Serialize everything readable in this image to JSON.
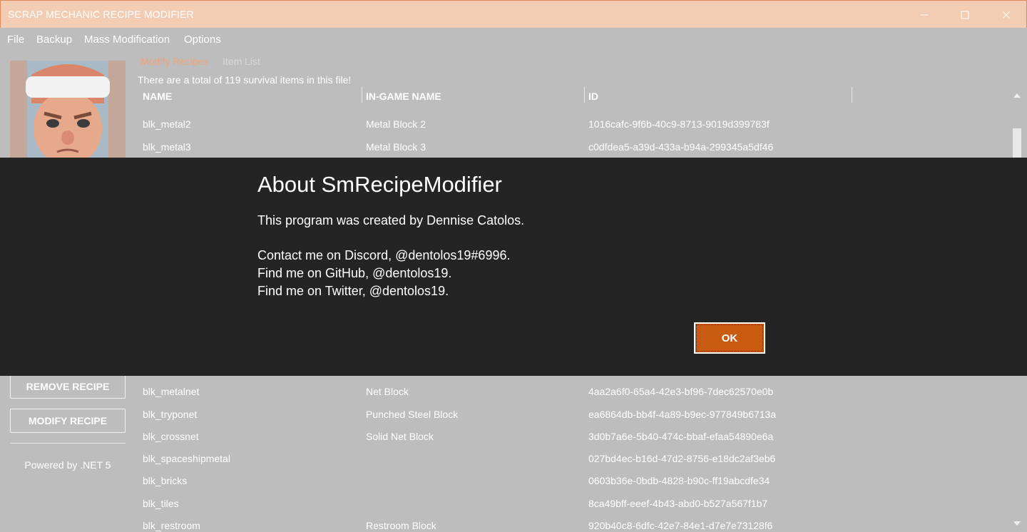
{
  "window": {
    "title": "SCRAP MECHANIC RECIPE MODIFIER",
    "minimize_icon": "minimize-icon",
    "maximize_icon": "maximize-icon",
    "close_icon": "close-icon"
  },
  "menu": [
    "File",
    "Backup",
    "Mass Modification",
    "Options"
  ],
  "tabs": {
    "modify": "Modify Recipes",
    "items": "Item List"
  },
  "info": {
    "total": "There are a total of 119 survival items in this file!"
  },
  "table": {
    "headers": [
      "NAME",
      "IN-GAME NAME",
      "ID"
    ],
    "top_rows": [
      {
        "name": "blk_metal2",
        "game": "Metal Block 2",
        "id": "1016cafc-9f6b-40c9-8713-9019d399783f"
      },
      {
        "name": "blk_metal3",
        "game": "Metal Block 3",
        "id": "c0dfdea5-a39d-433a-b94a-299345a5df46"
      }
    ],
    "bottom_rows": [
      {
        "name": "blk_metalnet",
        "game": "Net Block",
        "id": "4aa2a6f0-65a4-42e3-bf96-7dec62570e0b"
      },
      {
        "name": "blk_tryponet",
        "game": "Punched Steel Block",
        "id": "ea6864db-bb4f-4a89-b9ec-977849b6713a"
      },
      {
        "name": "blk_crossnet",
        "game": "Solid Net Block",
        "id": "3d0b7a6e-5b40-474c-bbaf-efaa54890e6a"
      },
      {
        "name": "blk_spaceshipmetal",
        "game": "",
        "id": "027bd4ec-b16d-47d2-8756-e18dc2af3eb6"
      },
      {
        "name": "blk_bricks",
        "game": "",
        "id": "0603b36e-0bdb-4828-b90c-ff19abcdfe34"
      },
      {
        "name": "blk_tiles",
        "game": "",
        "id": "8ca49bff-eeef-4b43-abd0-b527a567f1b7"
      },
      {
        "name": "blk_restroom",
        "game": "Restroom Block",
        "id": "920b40c8-6dfc-42e7-84e1-d7e7e73128f6"
      }
    ]
  },
  "sidebar": {
    "remove_label": "REMOVE RECIPE",
    "modify_label": "MODIFY RECIPE",
    "powered": "Powered by .NET 5"
  },
  "dialog": {
    "title": "About SmRecipeModifier",
    "line1": "This program was created by Dennise Catolos.",
    "line2": "Contact me on Discord, @dentolos19#6996.",
    "line3": "Find me on GitHub, @dentolos19.",
    "line4": "Find me on Twitter, @dentolos19.",
    "ok_label": "OK"
  },
  "colors": {
    "titlebar": "#f2cdb4",
    "content_bg": "#bdbdbd",
    "dialog_bg": "#242424",
    "accent": "#c95b10",
    "active_tab": "#f0a47a"
  }
}
